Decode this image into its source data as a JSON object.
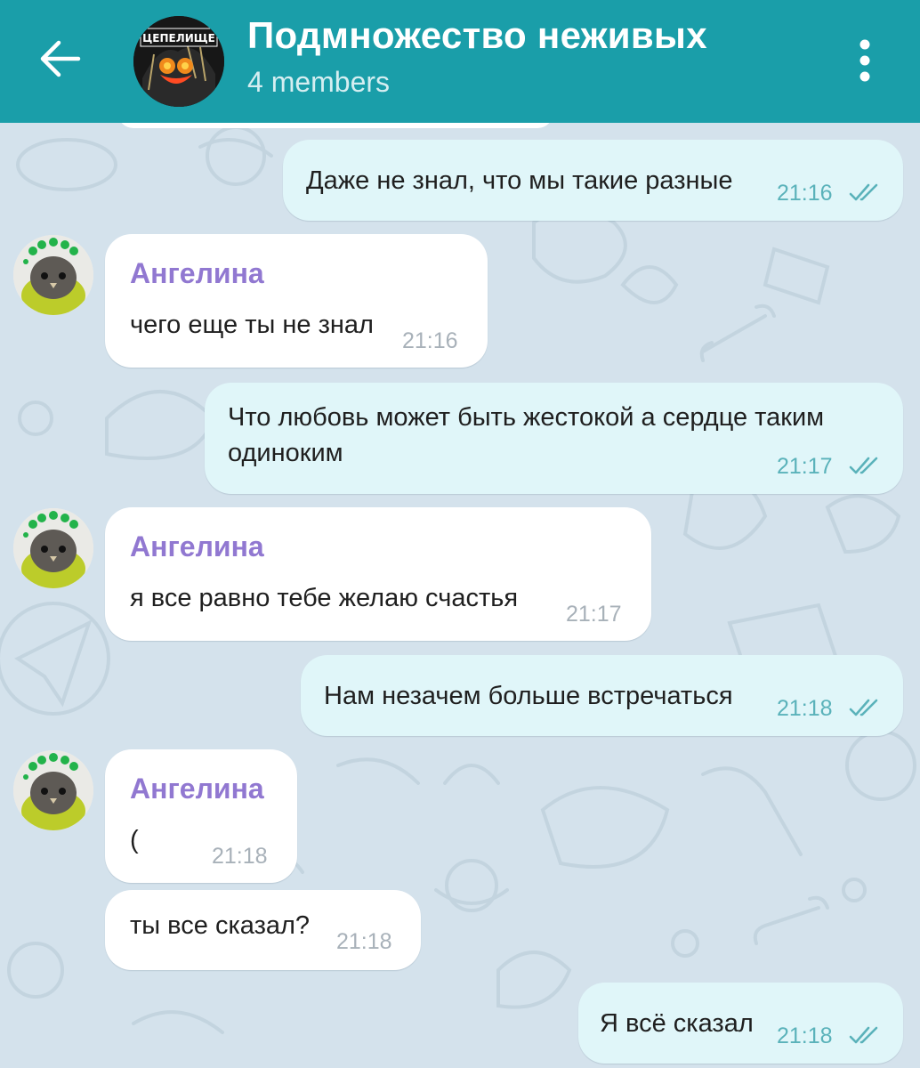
{
  "header": {
    "title": "Подмножество неживых",
    "subtitle": "4 members",
    "avatar_text": "ЦЕПЕЛИЩЕ",
    "back_icon": "arrow-left-icon",
    "more_icon": "more-vertical-icon",
    "bg_color": "#1a9ea9"
  },
  "chat": {
    "background_color": "#d4e2ec",
    "outgoing_bubble_color": "#e0f6f9",
    "incoming_bubble_color": "#ffffff",
    "sender_color": "#9178d1",
    "messages": [
      {
        "direction": "out",
        "text": "Даже не знал, что мы такие разные",
        "time": "21:16",
        "status": "read"
      },
      {
        "direction": "in",
        "sender": "Ангелина",
        "text": "чего еще ты не знал",
        "time": "21:16"
      },
      {
        "direction": "out",
        "lines": [
          "Что любовь может быть жестокой а сердце таким",
          "одиноким"
        ],
        "time": "21:17",
        "status": "read"
      },
      {
        "direction": "in",
        "sender": "Ангелина",
        "text": "я все равно тебе желаю  счастья",
        "time": "21:17"
      },
      {
        "direction": "out",
        "text": "Нам незачем больше встречаться",
        "time": "21:18",
        "status": "read"
      },
      {
        "direction": "in",
        "sender": "Ангелина",
        "text": "(",
        "time": "21:18"
      },
      {
        "direction": "in",
        "text": "ты все сказал?",
        "time": "21:18"
      },
      {
        "direction": "out",
        "text": "Я всё сказал",
        "time": "21:18",
        "status": "read"
      }
    ]
  }
}
